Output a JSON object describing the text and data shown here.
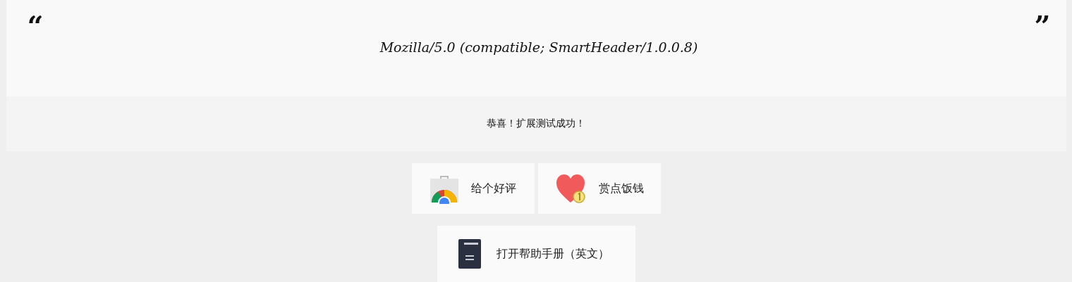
{
  "quote": {
    "open_mark": "“",
    "text": "Mozilla/5.0 (compatible; SmartHeader/1.0.0.8)",
    "close_mark": "”"
  },
  "message": "恭喜！扩展测试成功！",
  "buttons": [
    {
      "label": "给个好评",
      "kind": "review"
    },
    {
      "label": "赏点饭钱",
      "kind": "donate"
    },
    {
      "label": "打开帮助手册（英文）",
      "kind": "manual"
    }
  ]
}
